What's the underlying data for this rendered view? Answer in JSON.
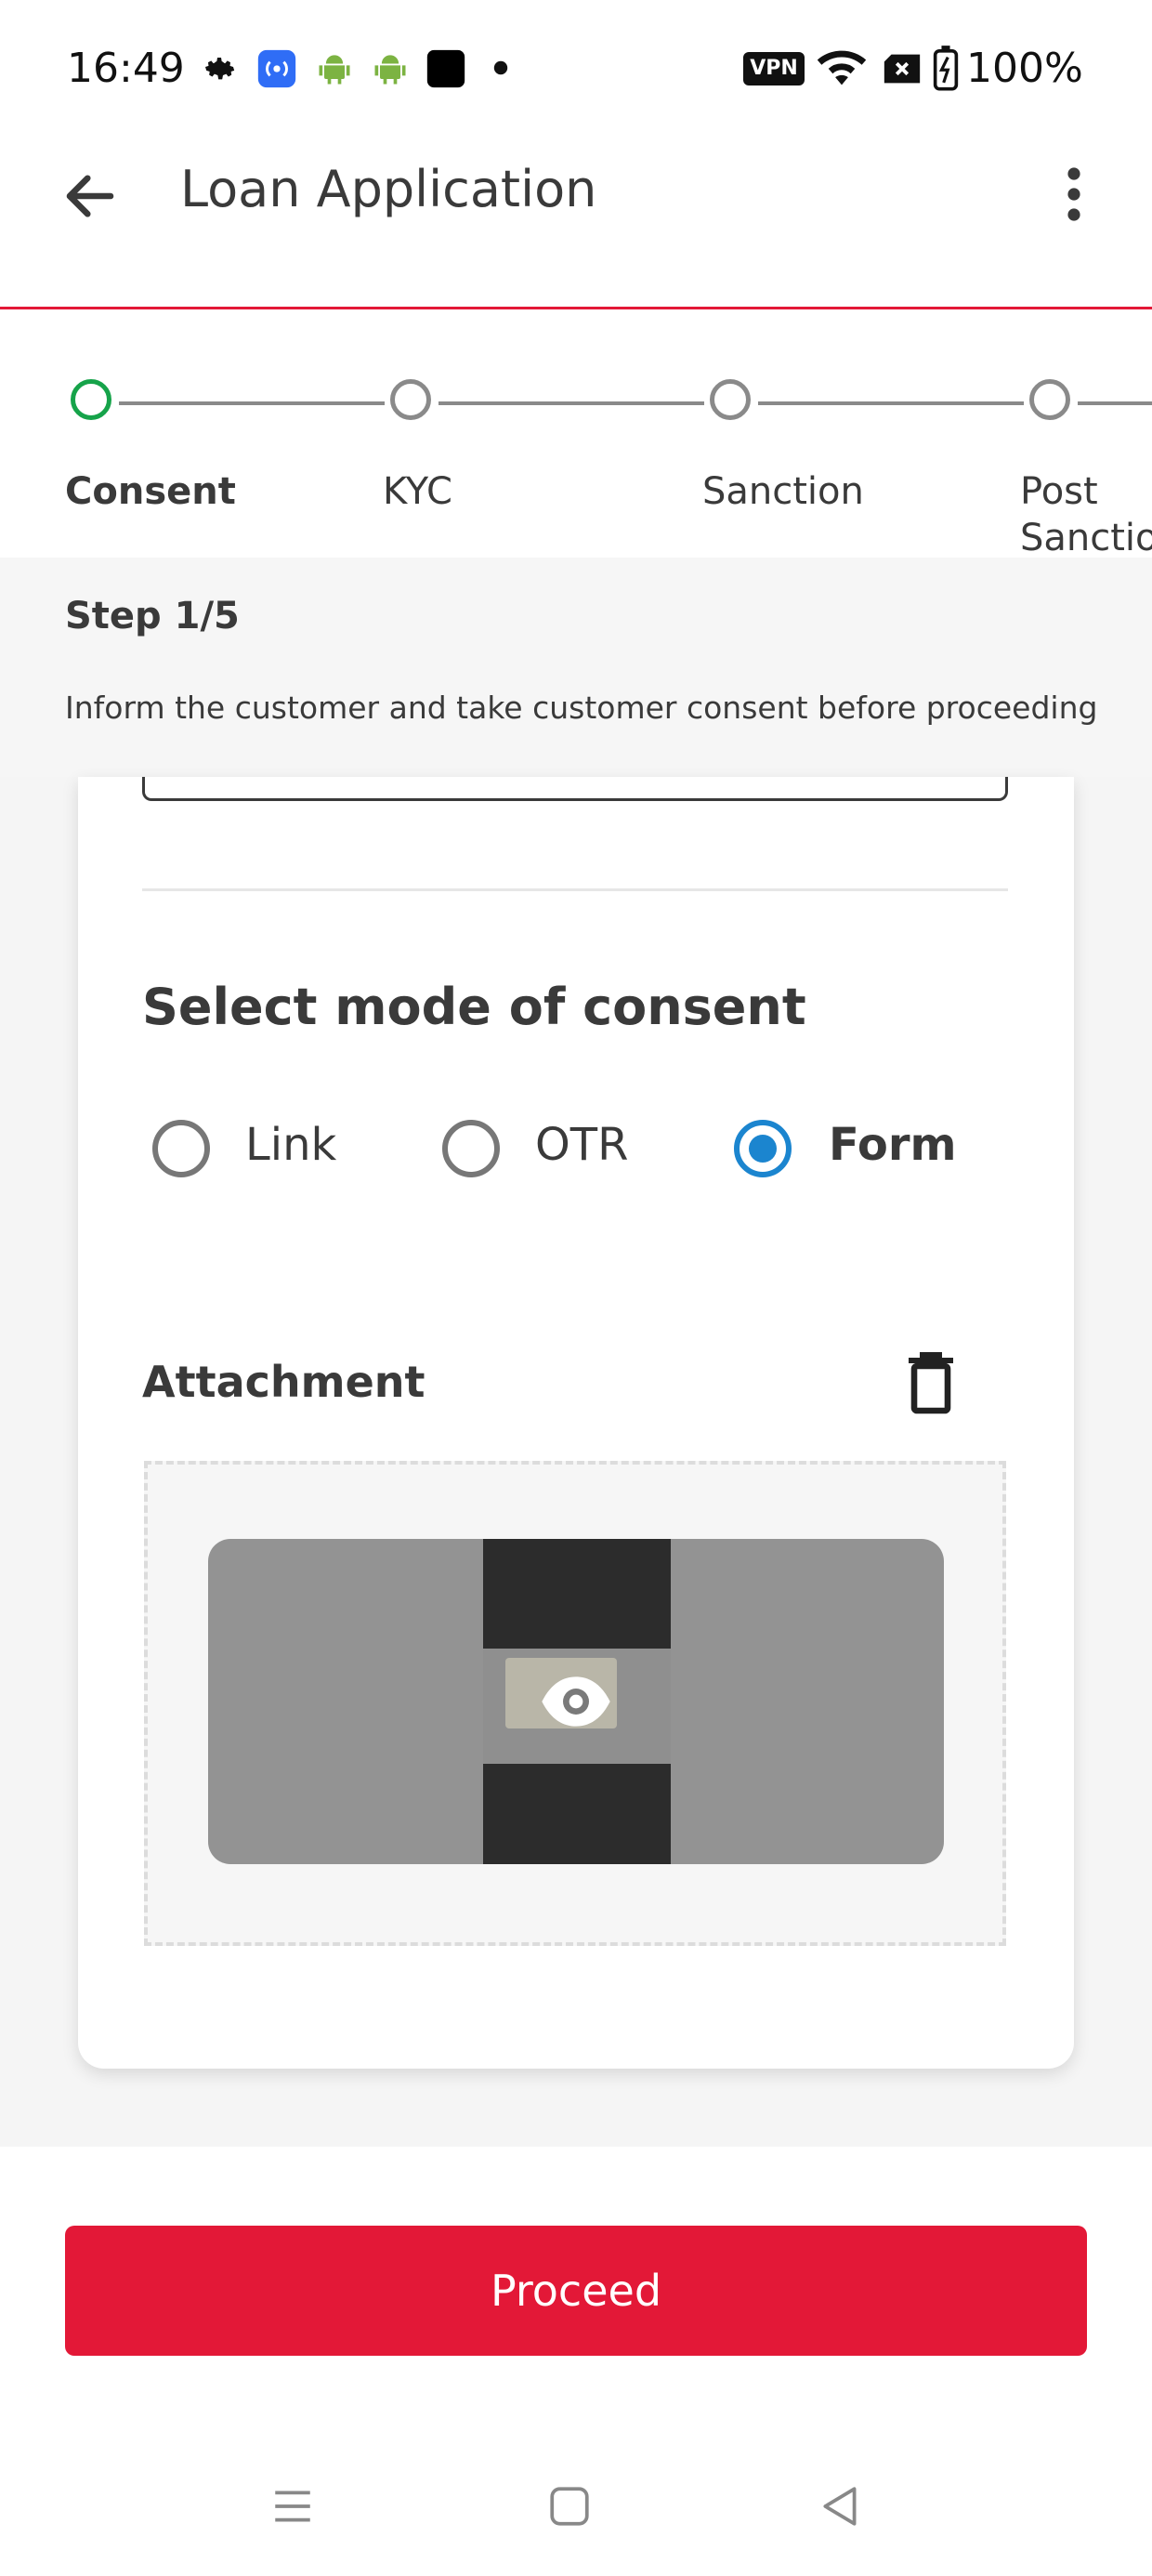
{
  "status_bar": {
    "time": "16:49",
    "icons": [
      "gear-icon",
      "hotspot-icon",
      "android-icon",
      "android-icon",
      "app-icon",
      "dot-icon"
    ],
    "right_icons": [
      "vpn-icon",
      "wifi-icon",
      "sim-off-icon",
      "battery-icon"
    ],
    "vpn_label": "VPN",
    "battery": "100%"
  },
  "app_bar": {
    "title": "Loan Application",
    "back_icon": "arrow-left-icon",
    "menu_icon": "more-vertical-icon"
  },
  "stepper": {
    "steps": [
      {
        "label": "Consent",
        "state": "active"
      },
      {
        "label": "KYC",
        "state": "pending"
      },
      {
        "label": "Sanction",
        "state": "pending"
      },
      {
        "label": "Post\nSanction",
        "state": "pending"
      }
    ],
    "active_color": "#16a34a"
  },
  "step_info": {
    "count": "Step 1/5",
    "description": "Inform the customer and take customer consent before proceeding"
  },
  "consent": {
    "heading": "Select mode of consent",
    "options": [
      {
        "label": "Link",
        "selected": false
      },
      {
        "label": "OTR",
        "selected": false
      },
      {
        "label": "Form",
        "selected": true
      }
    ]
  },
  "attachment": {
    "label": "Attachment",
    "delete_icon": "trash-icon",
    "preview_icon": "eye-icon"
  },
  "actions": {
    "proceed_label": "Proceed"
  },
  "nav": {
    "icons": [
      "menu-icon",
      "home-square-icon",
      "back-triangle-icon"
    ]
  },
  "colors": {
    "brand_red": "#e31837",
    "radio_blue": "#1b85cf",
    "step_green": "#16a34a"
  }
}
